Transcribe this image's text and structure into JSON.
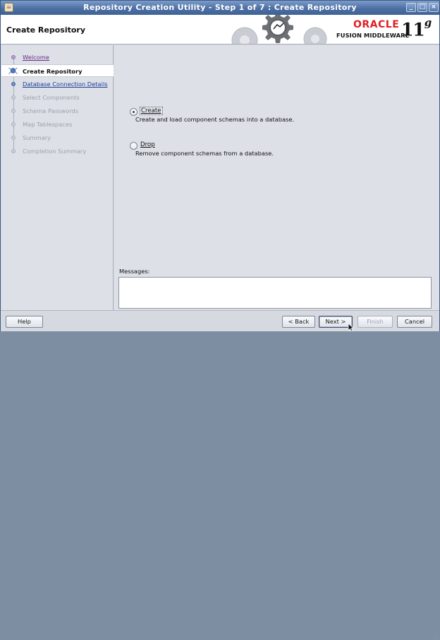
{
  "window": {
    "title": "Repository Creation Utility - Step 1 of 7 : Create Repository",
    "app_icon": "java-cup-icon",
    "controls": {
      "minimize": "_",
      "maximize": "□",
      "close": "×"
    }
  },
  "header": {
    "title": "Create Repository",
    "logo": {
      "oracle": "ORACLE",
      "product": "FUSION MIDDLEWARE",
      "version": "11",
      "version_sup": "g"
    }
  },
  "steps": [
    {
      "label": "Welcome",
      "state": "visited"
    },
    {
      "label": "Create Repository",
      "state": "active"
    },
    {
      "label": "Database Connection Details",
      "state": "link"
    },
    {
      "label": "Select Components",
      "state": "disabled"
    },
    {
      "label": "Schema Passwords",
      "state": "disabled"
    },
    {
      "label": "Map Tablespaces",
      "state": "disabled"
    },
    {
      "label": "Summary",
      "state": "disabled"
    },
    {
      "label": "Completion Summary",
      "state": "disabled"
    }
  ],
  "options": {
    "create": {
      "label": "Create",
      "description": "Create and load component schemas into a database.",
      "selected": true
    },
    "drop": {
      "label": "Drop",
      "description": "Remove component schemas from a database.",
      "selected": false
    }
  },
  "messages": {
    "label": "Messages:",
    "value": ""
  },
  "footer": {
    "help": "Help",
    "back": "< Back",
    "next": "Next >",
    "finish": "Finish",
    "cancel": "Cancel"
  }
}
